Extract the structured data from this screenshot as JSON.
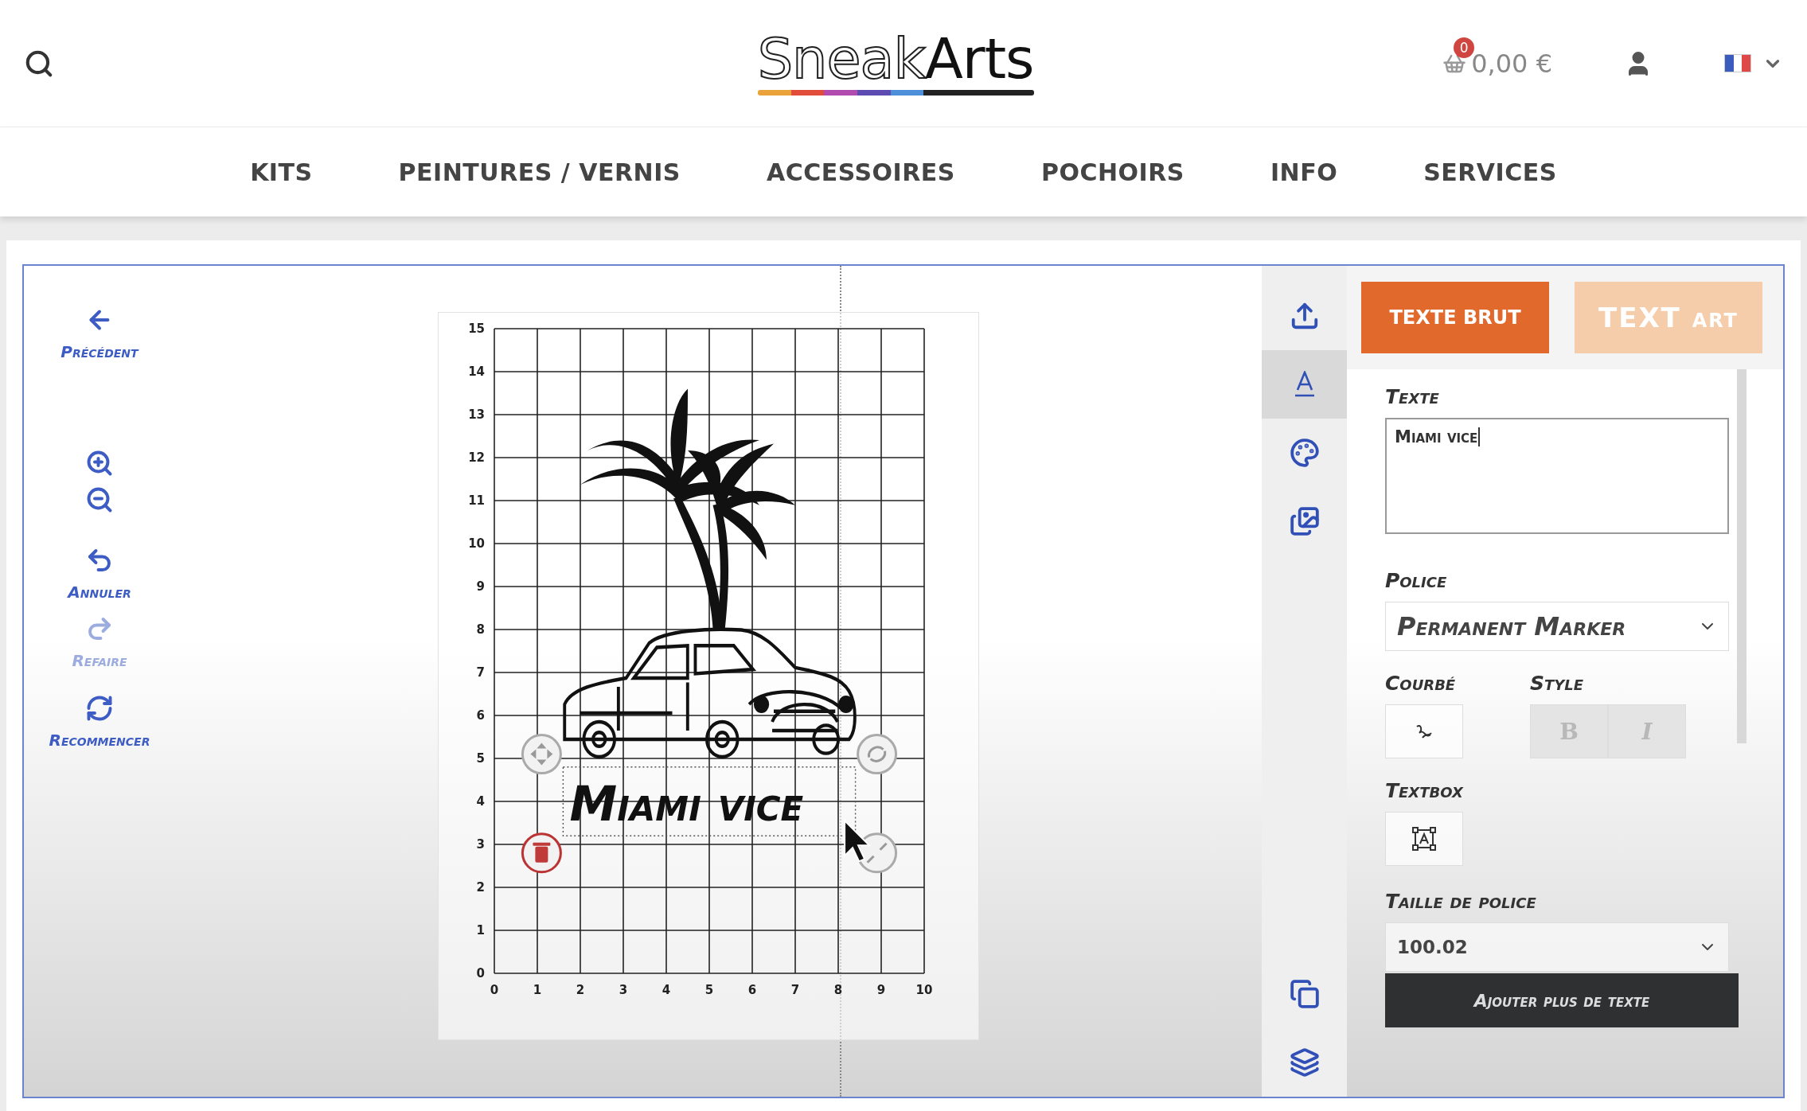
{
  "header": {
    "logo": {
      "part_1": "Sneak",
      "part_2": "Arts"
    },
    "cart_count": "0",
    "cart_total": "0,00 €"
  },
  "nav": [
    {
      "label": "KITS"
    },
    {
      "label": "PEINTURES / VERNIS"
    },
    {
      "label": "ACCESSOIRES"
    },
    {
      "label": "POCHOIRS"
    },
    {
      "label": "INFO"
    },
    {
      "label": "SERVICES"
    }
  ],
  "tools": [
    {
      "kind": "back",
      "label": "Précédent",
      "disabled": false
    },
    {
      "kind": "zoom_in",
      "disabled": false
    },
    {
      "kind": "zoom_out",
      "disabled": false
    },
    {
      "kind": "undo",
      "label": "Annuler",
      "disabled": false
    },
    {
      "kind": "redo",
      "label": "Refaire",
      "disabled": true
    },
    {
      "kind": "restart",
      "label": "Recommencer",
      "disabled": false
    }
  ],
  "canvas": {
    "x_ticks": [
      "0",
      "1",
      "2",
      "3",
      "4",
      "5",
      "6",
      "7",
      "8",
      "9",
      "10"
    ],
    "y_ticks": [
      "15",
      "14",
      "13",
      "12",
      "11",
      "10",
      "9",
      "8",
      "7",
      "6",
      "5",
      "4",
      "3",
      "2",
      "1",
      "0"
    ],
    "design_text": "Miami vice"
  },
  "side_icons": [
    {
      "kind": "upload",
      "selected": false
    },
    {
      "kind": "text",
      "selected": true
    },
    {
      "kind": "palette",
      "selected": false
    },
    {
      "kind": "images",
      "selected": false
    },
    {
      "kind": "duplicate",
      "selected": false
    },
    {
      "kind": "layers",
      "selected": false
    }
  ],
  "mode_tabs": [
    {
      "label": "TEXTE BRUT",
      "selected": true
    },
    {
      "label": "TEXT art",
      "selected": false
    }
  ],
  "text_panel": {
    "text_label": "Texte",
    "text_value": "Miami vice",
    "font_label": "Police",
    "font_value": "Permanent Marker",
    "curve_label": "Courbé",
    "style_label": "Style",
    "style_buttons": [
      {
        "kind": "bold",
        "label": "B",
        "disabled": true
      },
      {
        "kind": "italic",
        "label": "I",
        "disabled": true
      }
    ],
    "textbox_label": "Textbox",
    "size_label": "Taille de police",
    "size_value": "100.02",
    "add_button": "Ajouter plus de texte"
  }
}
